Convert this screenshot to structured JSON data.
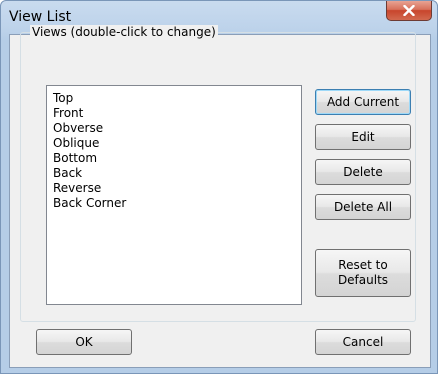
{
  "window": {
    "title": "View List",
    "close_glyph": "✕"
  },
  "group": {
    "label": "Views (double-click to change)"
  },
  "views": [
    "Top",
    "Front",
    "Obverse",
    "Oblique",
    "Bottom",
    "Back",
    "Reverse",
    "Back Corner"
  ],
  "buttons": {
    "add_current": "Add Current",
    "edit": "Edit",
    "delete": "Delete",
    "delete_all": "Delete All",
    "reset_line1": "Reset to",
    "reset_line2": "Defaults",
    "ok": "OK",
    "cancel": "Cancel"
  },
  "colors": {
    "close_button": "#c8452c",
    "title_bar": "#bcd2ea",
    "dialog_face": "#f0f0f0",
    "default_button_border": "#3c7fb1"
  }
}
